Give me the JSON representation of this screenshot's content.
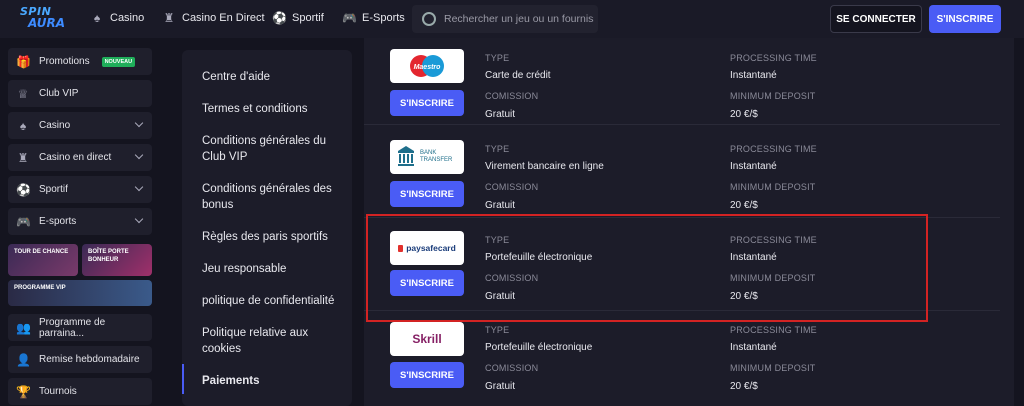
{
  "header": {
    "logo_line1": "SPIN",
    "logo_line2": "AURA",
    "nav": [
      {
        "label": "Casino",
        "icon": "spade-icon"
      },
      {
        "label": "Casino En Direct",
        "icon": "dealer-icon"
      },
      {
        "label": "Sportif",
        "icon": "ball-icon"
      },
      {
        "label": "E-Sports",
        "icon": "gamepad-icon"
      }
    ],
    "search_placeholder": "Rechercher un jeu ou un fournisseur",
    "login_label": "SE CONNECTER",
    "signup_label": "S'INSCRIRE"
  },
  "sidebar": {
    "items": [
      {
        "label": "Promotions",
        "badge": "NOUVEAU"
      },
      {
        "label": "Club VIP"
      },
      {
        "label": "Casino"
      },
      {
        "label": "Casino en direct"
      },
      {
        "label": "Sportif"
      },
      {
        "label": "E-sports"
      }
    ],
    "tiles": {
      "tour_de_chance": "TOUR DE CHANCE",
      "boite_porte_bonheur": "BOÎTE PORTE BONHEUR",
      "programme_vip": "PROGRAMME VIP"
    },
    "bottom_items": [
      {
        "label": "Programme de parraina..."
      },
      {
        "label": "Remise hebdomadaire"
      },
      {
        "label": "Tournois"
      }
    ]
  },
  "menu": {
    "items": [
      "Centre d'aide",
      "Termes et conditions",
      "Conditions générales du Club VIP",
      "Conditions générales des bonus",
      "Règles des paris sportifs",
      "Jeu responsable",
      "politique de confidentialité",
      "Politique relative aux cookies",
      "Paiements"
    ],
    "active": "Paiements"
  },
  "payments": {
    "labels": {
      "type": "TYPE",
      "processing": "PROCESSING TIME",
      "commission": "COMISSION",
      "min_deposit": "MINIMUM DEPOSIT"
    },
    "button_label": "S'INSCRIRE",
    "methods": [
      {
        "name": "Maestro",
        "type": "Carte de crédit",
        "processing": "Instantané",
        "commission": "Gratuit",
        "min_deposit": "20 €/$"
      },
      {
        "name": "BANK TRANSFER",
        "type": "Virement bancaire en ligne",
        "processing": "Instantané",
        "commission": "Gratuit",
        "min_deposit": "20 €/$"
      },
      {
        "name": "paysafecard",
        "type": "Portefeuille électronique",
        "processing": "Instantané",
        "commission": "Gratuit",
        "min_deposit": "20 €/$"
      },
      {
        "name": "Skrill",
        "type": "Portefeuille électronique",
        "processing": "Instantané",
        "commission": "Gratuit",
        "min_deposit": "20 €/$"
      }
    ],
    "highlighted_index": 2
  },
  "colors": {
    "accent": "#4a5cf5",
    "highlight": "#d32323",
    "bg": "#14141f",
    "panel": "#1c1c29"
  }
}
